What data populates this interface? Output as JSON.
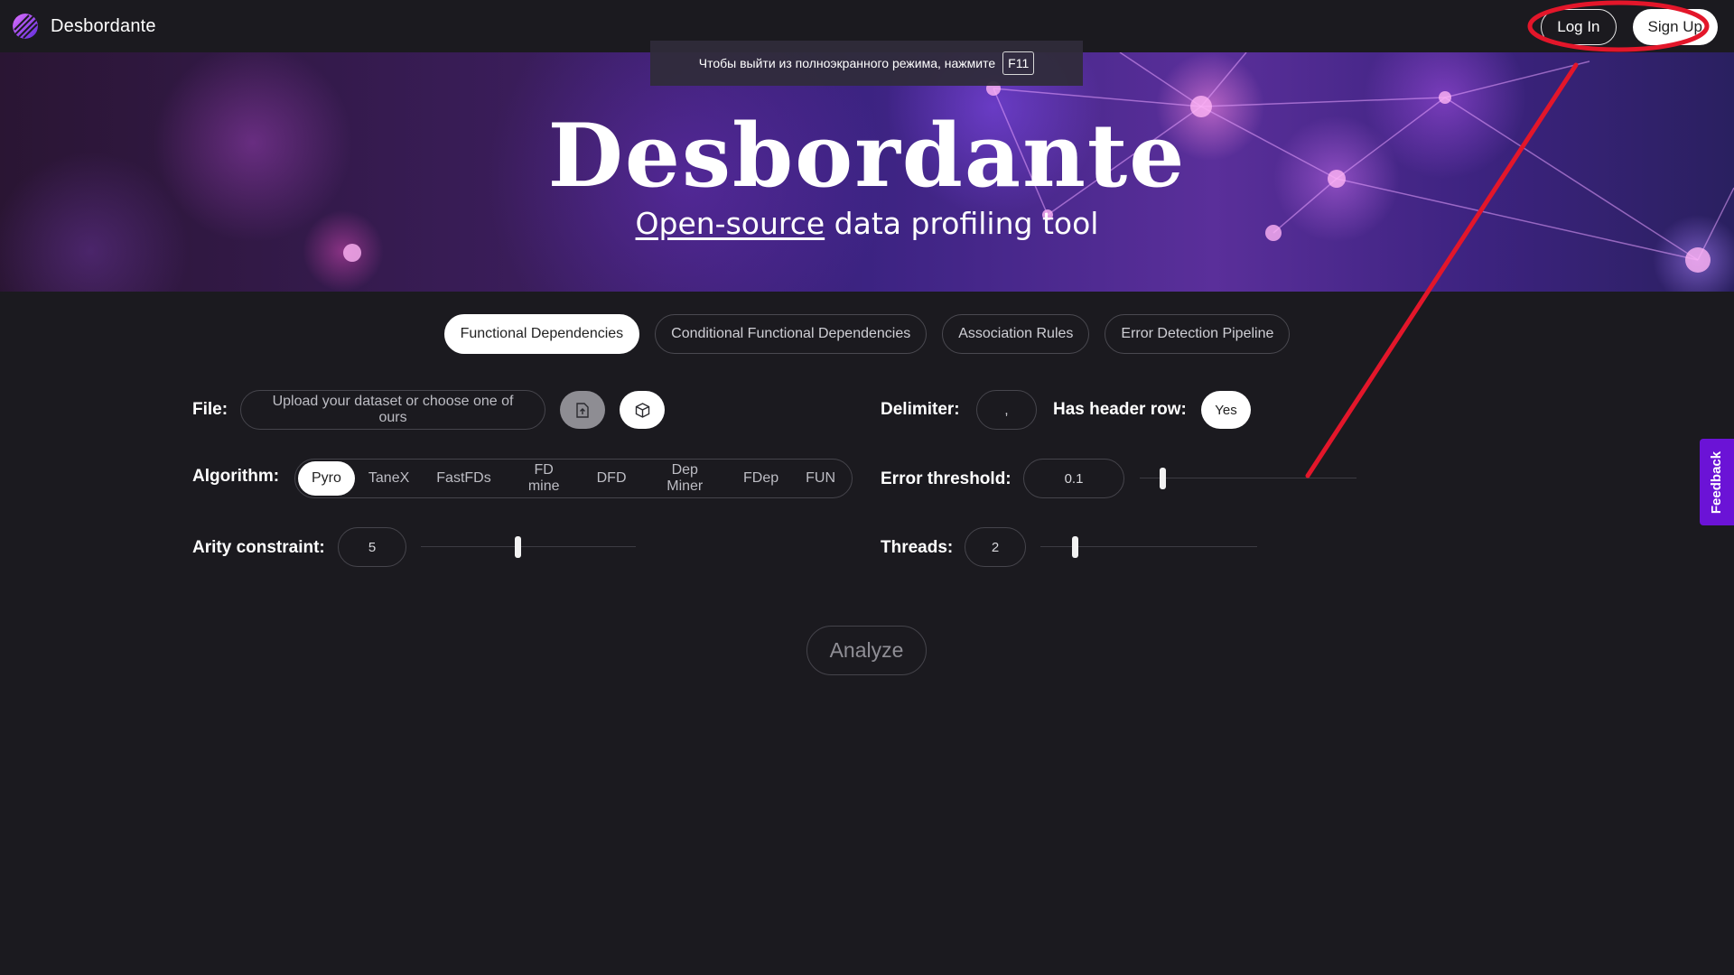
{
  "brand": {
    "name": "Desbordante",
    "logo_icon": "desbordante-logo-icon"
  },
  "auth": {
    "login_label": "Log In",
    "signup_label": "Sign Up"
  },
  "fullscreen_notice": {
    "text": "Чтобы выйти из полноэкранного режима, нажмите",
    "key": "F11"
  },
  "hero": {
    "title": "Desbordante",
    "subtitle_link": "Open-source",
    "subtitle_rest": " data profiling tool"
  },
  "tabs": [
    {
      "label": "Functional Dependencies",
      "active": true
    },
    {
      "label": "Conditional Functional Dependencies",
      "active": false
    },
    {
      "label": "Association Rules",
      "active": false
    },
    {
      "label": "Error Detection Pipeline",
      "active": false
    }
  ],
  "form": {
    "file": {
      "label": "File:",
      "placeholder": "Upload your dataset or choose one of ours",
      "upload_icon": "file-upload-icon",
      "builtin_icon": "box-icon"
    },
    "algorithm": {
      "label": "Algorithm:",
      "options": [
        "Pyro",
        "TaneX",
        "FastFDs",
        "FD mine",
        "DFD",
        "Dep Miner",
        "FDep",
        "FUN"
      ],
      "selected": "Pyro"
    },
    "arity": {
      "label": "Arity constraint:",
      "value": "5"
    },
    "delimiter": {
      "label": "Delimiter:",
      "value": ","
    },
    "header_row": {
      "label": "Has header row:",
      "value": "Yes"
    },
    "error_threshold": {
      "label": "Error threshold:",
      "value": "0.1"
    },
    "threads": {
      "label": "Threads:",
      "value": "2"
    }
  },
  "analyze_label": "Analyze",
  "feedback_label": "Feedback",
  "colors": {
    "background": "#1b1a1f",
    "feedback": "#6b13d6",
    "annotation": "#e3162a"
  }
}
